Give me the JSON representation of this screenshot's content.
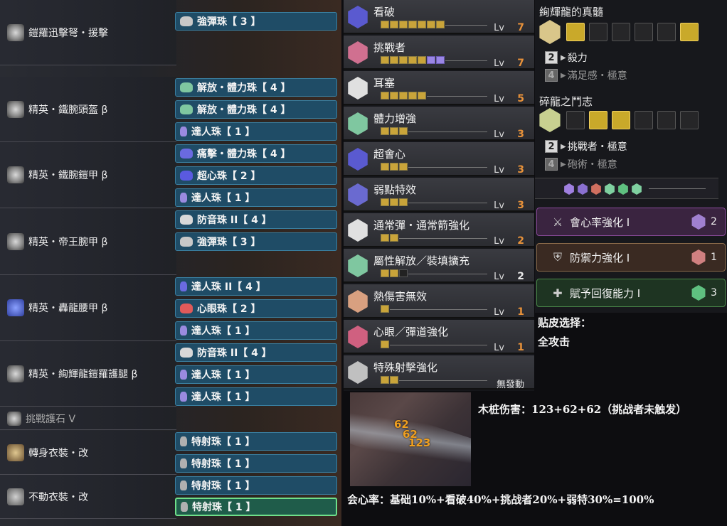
{
  "equipment": [
    {
      "name": "鎧羅迅擊弩・援擊",
      "decos": [
        {
          "label": "強彈珠【 3 】",
          "color": "#c8c8c8"
        }
      ]
    },
    {
      "name": "精英・鐵腕頭盔 β",
      "decos": [
        {
          "label": "解放・體力珠【 4 】",
          "color": "#7fc7a0"
        },
        {
          "label": "解放・體力珠【 4 】",
          "color": "#7fc7a0"
        },
        {
          "label": "達人珠【 1 】",
          "color": "#9a8ae0"
        }
      ]
    },
    {
      "name": "精英・鐵腕鎧甲 β",
      "decos": [
        {
          "label": "痛擊・體力珠【 4 】",
          "color": "#6a6ae0"
        },
        {
          "label": "超心珠【 2 】",
          "color": "#5a5ae0"
        },
        {
          "label": "達人珠【 1 】",
          "color": "#9a8ae0"
        }
      ]
    },
    {
      "name": "精英・帝王腕甲 β",
      "decos": [
        {
          "label": "防音珠 II【 4 】",
          "color": "#d8d8d8"
        },
        {
          "label": "強彈珠【 3 】",
          "color": "#c8c8c8"
        }
      ]
    },
    {
      "name": "精英・轟龍腰甲 β",
      "decos": [
        {
          "label": "達人珠 II【 4 】",
          "color": "#6a6ae0"
        },
        {
          "label": "心眼珠【 2 】",
          "color": "#e05a5a"
        },
        {
          "label": "達人珠【 1 】",
          "color": "#9a8ae0"
        }
      ]
    },
    {
      "name": "精英・絢輝龍鎧羅護腿 β",
      "decos": [
        {
          "label": "防音珠 II【 4 】",
          "color": "#d8d8d8"
        },
        {
          "label": "達人珠【 1 】",
          "color": "#9a8ae0"
        },
        {
          "label": "達人珠【 1 】",
          "color": "#9a8ae0"
        }
      ]
    },
    {
      "name": "挑戰護石 V",
      "decos": []
    },
    {
      "name": "轉身衣裝・改",
      "decos": [
        {
          "label": "特射珠【 1 】",
          "color": "#b0b0b0"
        },
        {
          "label": "特射珠【 1 】",
          "color": "#b0b0b0"
        }
      ]
    },
    {
      "name": "不動衣裝・改",
      "decos": [
        {
          "label": "特射珠【 1 】",
          "color": "#b0b0b0"
        },
        {
          "label": "特射珠【 1 】",
          "color": "#b0b0b0"
        }
      ]
    }
  ],
  "skills": [
    {
      "name": "看破",
      "filled": 7,
      "purple": 0,
      "max": 7,
      "lv_label": "Lv",
      "lv": "7",
      "icon_color": "#5a5ad0"
    },
    {
      "name": "挑戰者",
      "filled": 5,
      "purple": 2,
      "max": 7,
      "lv_label": "Lv",
      "lv": "7",
      "icon_color": "#d07090"
    },
    {
      "name": "耳塞",
      "filled": 5,
      "purple": 0,
      "max": 5,
      "lv_label": "Lv",
      "lv": "5",
      "icon_color": "#e0e0e0"
    },
    {
      "name": "體力增強",
      "filled": 3,
      "purple": 0,
      "max": 3,
      "lv_label": "Lv",
      "lv": "3",
      "icon_color": "#7fc7a0"
    },
    {
      "name": "超會心",
      "filled": 3,
      "purple": 0,
      "max": 3,
      "lv_label": "Lv",
      "lv": "3",
      "icon_color": "#5a5ad0"
    },
    {
      "name": "弱點特效",
      "filled": 3,
      "purple": 0,
      "max": 3,
      "lv_label": "Lv",
      "lv": "3",
      "icon_color": "#6a6ad0"
    },
    {
      "name": "通常彈・通常箭強化",
      "filled": 2,
      "purple": 0,
      "max": 2,
      "lv_label": "Lv",
      "lv": "2",
      "icon_color": "#e0e0e0"
    },
    {
      "name": "屬性解放／裝填擴充",
      "filled": 2,
      "purple": 0,
      "max": 3,
      "lv_label": "Lv",
      "lv": "2",
      "icon_color": "#7fc7a0",
      "lv_white": true
    },
    {
      "name": "熱傷害無效",
      "filled": 1,
      "purple": 0,
      "max": 1,
      "lv_label": "Lv",
      "lv": "1",
      "icon_color": "#d8a080"
    },
    {
      "name": "心眼／彈道強化",
      "filled": 1,
      "purple": 0,
      "max": 1,
      "lv_label": "Lv",
      "lv": "1",
      "icon_color": "#d06080"
    },
    {
      "name": "特殊射擊強化",
      "filled": 2,
      "purple": 0,
      "max": 2,
      "lv_label": "",
      "lv": "無發動",
      "icon_color": "#c0c0c0",
      "inactive": true
    }
  ],
  "set_bonuses": [
    {
      "title": "絢輝龍的真髓",
      "pieces": [
        true,
        false,
        false,
        false,
        false,
        true
      ],
      "rows": [
        {
          "num": "2",
          "label": "殺力",
          "active": true
        },
        {
          "num": "4",
          "label": "滿足感・極意",
          "active": false
        }
      ]
    },
    {
      "title": "碎龍之鬥志",
      "pieces": [
        false,
        true,
        true,
        false,
        false,
        false
      ],
      "rows": [
        {
          "num": "2",
          "label": "挑戰者・極意",
          "active": true
        },
        {
          "num": "4",
          "label": "砲術・極意",
          "active": false
        }
      ]
    }
  ],
  "slot_gems": [
    "#a080e0",
    "#8a70d0",
    "#d07060",
    "#7fd0a0",
    "#5fc080",
    "#7fd0a0"
  ],
  "augments": [
    {
      "label": "會心率強化 I",
      "count": "2",
      "bg": "#3a2440",
      "border": "#8a4a9a",
      "gem": "#a080d0"
    },
    {
      "label": "防禦力強化 I",
      "count": "1",
      "bg": "#3a2a22",
      "border": "#8a6a4a",
      "gem": "#d08080"
    },
    {
      "label": "賦予回復能力 I",
      "count": "3",
      "bg": "#1e3422",
      "border": "#4a8a4a",
      "gem": "#5fc080"
    }
  ],
  "notes": {
    "upgrade_title": "贴皮选择：",
    "upgrade_value": "全攻击",
    "dummy_damage": "木桩伤害：123+62+62（挑战者未触发）",
    "crit_rate": "会心率：基础10%+看破40%+挑战者20%+弱特30%=100%"
  },
  "screenshot": {
    "numbers": [
      "62",
      "62",
      "123"
    ]
  }
}
